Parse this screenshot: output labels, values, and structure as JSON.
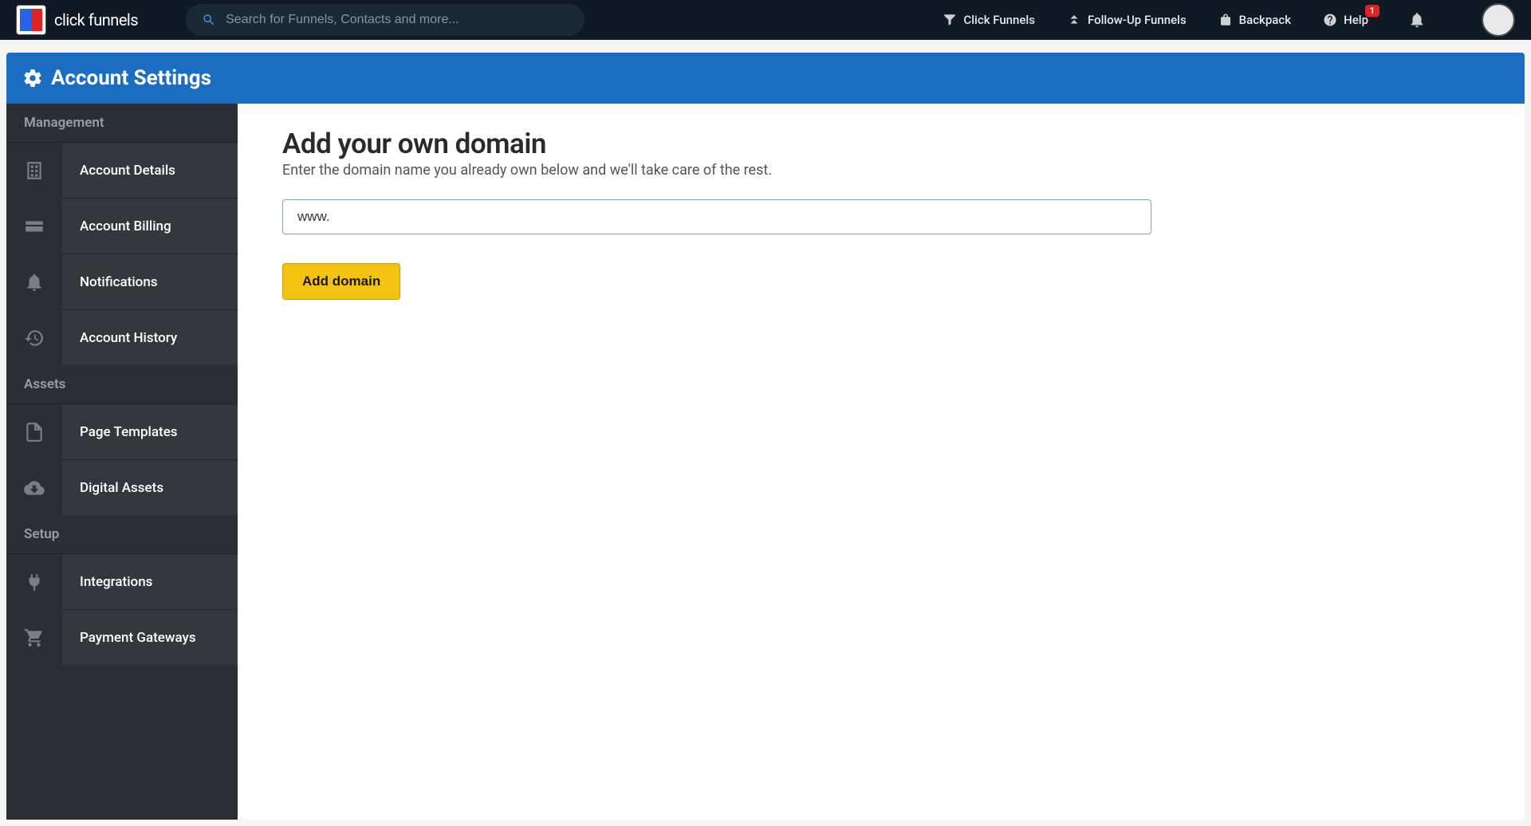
{
  "brand": "click funnels",
  "search": {
    "placeholder": "Search for Funnels, Contacts and more..."
  },
  "topnav": {
    "click_funnels": "Click Funnels",
    "followup_funnels": "Follow-Up Funnels",
    "backpack": "Backpack",
    "help": "Help",
    "help_badge": "1"
  },
  "page_header": {
    "title": "Account Settings"
  },
  "sidebar": {
    "section_management": "Management",
    "section_assets": "Assets",
    "section_setup": "Setup",
    "items": {
      "account_details": "Account Details",
      "account_billing": "Account Billing",
      "notifications": "Notifications",
      "account_history": "Account History",
      "page_templates": "Page Templates",
      "digital_assets": "Digital Assets",
      "integrations": "Integrations",
      "payment_gateways": "Payment Gateways"
    }
  },
  "main": {
    "title": "Add your own domain",
    "subtitle": "Enter the domain name you already own below and we'll take care of the rest.",
    "domain_value": "www.",
    "add_button": "Add domain"
  }
}
